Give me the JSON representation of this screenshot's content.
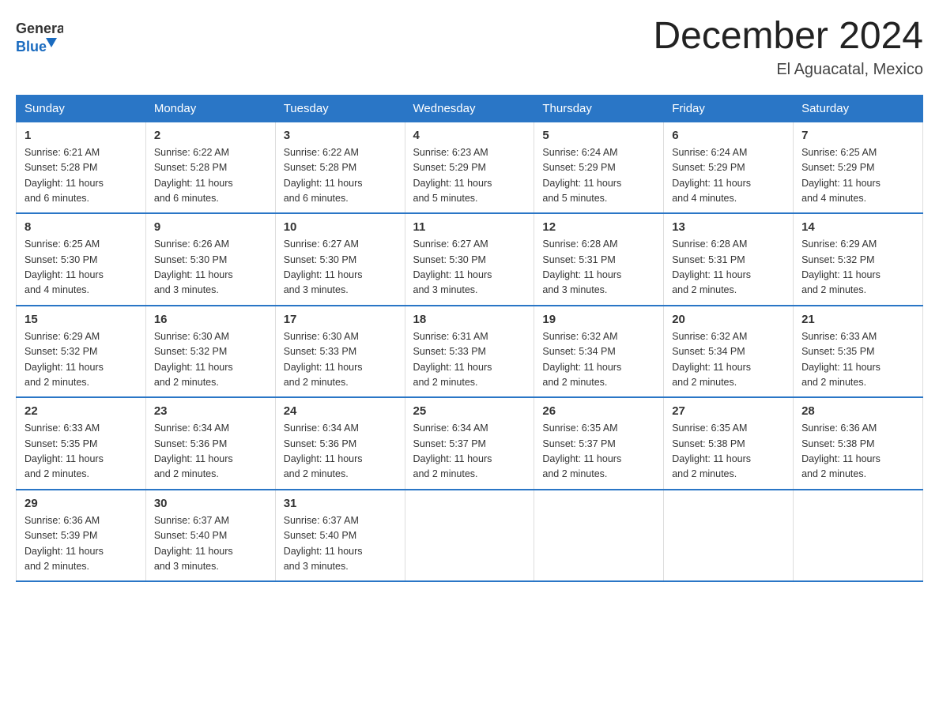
{
  "logo": {
    "general": "General",
    "blue": "Blue"
  },
  "header": {
    "title": "December 2024",
    "location": "El Aguacatal, Mexico"
  },
  "days_of_week": [
    "Sunday",
    "Monday",
    "Tuesday",
    "Wednesday",
    "Thursday",
    "Friday",
    "Saturday"
  ],
  "weeks": [
    [
      {
        "day": "1",
        "info": "Sunrise: 6:21 AM\nSunset: 5:28 PM\nDaylight: 11 hours\nand 6 minutes."
      },
      {
        "day": "2",
        "info": "Sunrise: 6:22 AM\nSunset: 5:28 PM\nDaylight: 11 hours\nand 6 minutes."
      },
      {
        "day": "3",
        "info": "Sunrise: 6:22 AM\nSunset: 5:28 PM\nDaylight: 11 hours\nand 6 minutes."
      },
      {
        "day": "4",
        "info": "Sunrise: 6:23 AM\nSunset: 5:29 PM\nDaylight: 11 hours\nand 5 minutes."
      },
      {
        "day": "5",
        "info": "Sunrise: 6:24 AM\nSunset: 5:29 PM\nDaylight: 11 hours\nand 5 minutes."
      },
      {
        "day": "6",
        "info": "Sunrise: 6:24 AM\nSunset: 5:29 PM\nDaylight: 11 hours\nand 4 minutes."
      },
      {
        "day": "7",
        "info": "Sunrise: 6:25 AM\nSunset: 5:29 PM\nDaylight: 11 hours\nand 4 minutes."
      }
    ],
    [
      {
        "day": "8",
        "info": "Sunrise: 6:25 AM\nSunset: 5:30 PM\nDaylight: 11 hours\nand 4 minutes."
      },
      {
        "day": "9",
        "info": "Sunrise: 6:26 AM\nSunset: 5:30 PM\nDaylight: 11 hours\nand 3 minutes."
      },
      {
        "day": "10",
        "info": "Sunrise: 6:27 AM\nSunset: 5:30 PM\nDaylight: 11 hours\nand 3 minutes."
      },
      {
        "day": "11",
        "info": "Sunrise: 6:27 AM\nSunset: 5:30 PM\nDaylight: 11 hours\nand 3 minutes."
      },
      {
        "day": "12",
        "info": "Sunrise: 6:28 AM\nSunset: 5:31 PM\nDaylight: 11 hours\nand 3 minutes."
      },
      {
        "day": "13",
        "info": "Sunrise: 6:28 AM\nSunset: 5:31 PM\nDaylight: 11 hours\nand 2 minutes."
      },
      {
        "day": "14",
        "info": "Sunrise: 6:29 AM\nSunset: 5:32 PM\nDaylight: 11 hours\nand 2 minutes."
      }
    ],
    [
      {
        "day": "15",
        "info": "Sunrise: 6:29 AM\nSunset: 5:32 PM\nDaylight: 11 hours\nand 2 minutes."
      },
      {
        "day": "16",
        "info": "Sunrise: 6:30 AM\nSunset: 5:32 PM\nDaylight: 11 hours\nand 2 minutes."
      },
      {
        "day": "17",
        "info": "Sunrise: 6:30 AM\nSunset: 5:33 PM\nDaylight: 11 hours\nand 2 minutes."
      },
      {
        "day": "18",
        "info": "Sunrise: 6:31 AM\nSunset: 5:33 PM\nDaylight: 11 hours\nand 2 minutes."
      },
      {
        "day": "19",
        "info": "Sunrise: 6:32 AM\nSunset: 5:34 PM\nDaylight: 11 hours\nand 2 minutes."
      },
      {
        "day": "20",
        "info": "Sunrise: 6:32 AM\nSunset: 5:34 PM\nDaylight: 11 hours\nand 2 minutes."
      },
      {
        "day": "21",
        "info": "Sunrise: 6:33 AM\nSunset: 5:35 PM\nDaylight: 11 hours\nand 2 minutes."
      }
    ],
    [
      {
        "day": "22",
        "info": "Sunrise: 6:33 AM\nSunset: 5:35 PM\nDaylight: 11 hours\nand 2 minutes."
      },
      {
        "day": "23",
        "info": "Sunrise: 6:34 AM\nSunset: 5:36 PM\nDaylight: 11 hours\nand 2 minutes."
      },
      {
        "day": "24",
        "info": "Sunrise: 6:34 AM\nSunset: 5:36 PM\nDaylight: 11 hours\nand 2 minutes."
      },
      {
        "day": "25",
        "info": "Sunrise: 6:34 AM\nSunset: 5:37 PM\nDaylight: 11 hours\nand 2 minutes."
      },
      {
        "day": "26",
        "info": "Sunrise: 6:35 AM\nSunset: 5:37 PM\nDaylight: 11 hours\nand 2 minutes."
      },
      {
        "day": "27",
        "info": "Sunrise: 6:35 AM\nSunset: 5:38 PM\nDaylight: 11 hours\nand 2 minutes."
      },
      {
        "day": "28",
        "info": "Sunrise: 6:36 AM\nSunset: 5:38 PM\nDaylight: 11 hours\nand 2 minutes."
      }
    ],
    [
      {
        "day": "29",
        "info": "Sunrise: 6:36 AM\nSunset: 5:39 PM\nDaylight: 11 hours\nand 2 minutes."
      },
      {
        "day": "30",
        "info": "Sunrise: 6:37 AM\nSunset: 5:40 PM\nDaylight: 11 hours\nand 3 minutes."
      },
      {
        "day": "31",
        "info": "Sunrise: 6:37 AM\nSunset: 5:40 PM\nDaylight: 11 hours\nand 3 minutes."
      },
      {
        "day": "",
        "info": ""
      },
      {
        "day": "",
        "info": ""
      },
      {
        "day": "",
        "info": ""
      },
      {
        "day": "",
        "info": ""
      }
    ]
  ]
}
